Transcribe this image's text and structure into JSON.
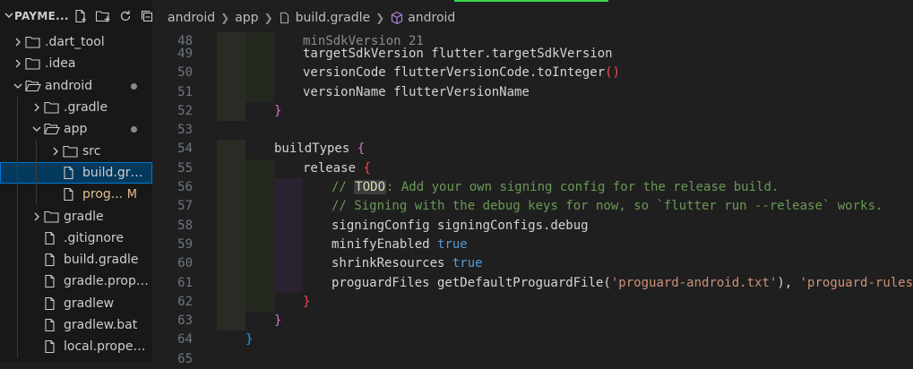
{
  "explorer": {
    "title": "PAYME...",
    "tree": [
      {
        "label": ".dart_tool",
        "kind": "folder",
        "expanded": false,
        "depth": 0
      },
      {
        "label": ".idea",
        "kind": "folder",
        "expanded": false,
        "depth": 0
      },
      {
        "label": "android",
        "kind": "folder",
        "expanded": true,
        "depth": 0,
        "dot": true
      },
      {
        "label": ".gradle",
        "kind": "folder",
        "expanded": false,
        "depth": 1
      },
      {
        "label": "app",
        "kind": "folder",
        "expanded": true,
        "depth": 1,
        "dot": true
      },
      {
        "label": "src",
        "kind": "folder",
        "expanded": false,
        "depth": 2
      },
      {
        "label": "build.gradle",
        "kind": "file",
        "depth": 2,
        "selected": true
      },
      {
        "label": "prog...",
        "kind": "file",
        "depth": 2,
        "badge": "M"
      },
      {
        "label": "gradle",
        "kind": "folder",
        "expanded": false,
        "depth": 1
      },
      {
        "label": ".gitignore",
        "kind": "file",
        "depth": 1
      },
      {
        "label": "build.gradle",
        "kind": "file",
        "depth": 1
      },
      {
        "label": "gradle.propert...",
        "kind": "file",
        "depth": 1
      },
      {
        "label": "gradlew",
        "kind": "file",
        "depth": 1
      },
      {
        "label": "gradlew.bat",
        "kind": "file",
        "depth": 1
      },
      {
        "label": "local.properties",
        "kind": "file",
        "depth": 1
      }
    ]
  },
  "breadcrumb": [
    "android",
    "app",
    "build.gradle",
    "android"
  ],
  "editor": {
    "lines": [
      {
        "n": "48",
        "text": "minSdkVersion 21"
      },
      {
        "n": "49",
        "text": "targetSdkVersion flutter.targetSdkVersion"
      },
      {
        "n": "50",
        "text": "versionCode flutterVersionCode.toInteger()"
      },
      {
        "n": "51",
        "text": "versionName flutterVersionName"
      },
      {
        "n": "52",
        "text": "}"
      },
      {
        "n": "53",
        "text": ""
      },
      {
        "n": "54",
        "text": "buildTypes {"
      },
      {
        "n": "55",
        "text": "release {"
      },
      {
        "n": "56",
        "text": "// TODO: Add your own signing config for the release build."
      },
      {
        "n": "57",
        "text": "// Signing with the debug keys for now, so `flutter run --release` works."
      },
      {
        "n": "58",
        "text": "signingConfig signingConfigs.debug"
      },
      {
        "n": "59",
        "text": "minifyEnabled true"
      },
      {
        "n": "60",
        "text": "shrinkResources true"
      },
      {
        "n": "61",
        "text": "proguardFiles getDefaultProguardFile('proguard-android.txt'), 'proguard-rules.pro'"
      },
      {
        "n": "62",
        "text": "}"
      },
      {
        "n": "63",
        "text": "}"
      },
      {
        "n": "64",
        "text": "}"
      },
      {
        "n": "65",
        "text": ""
      }
    ]
  },
  "colors": {
    "selection": "#04395e",
    "modified": "#e2c08d",
    "comment": "#6a9955",
    "keyword": "#569cd6",
    "string": "#ce9178",
    "active_tab": "#3bd44a"
  }
}
